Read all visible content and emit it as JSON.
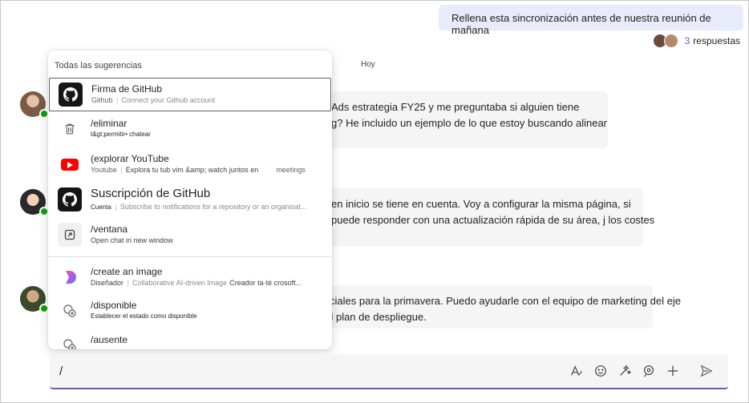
{
  "chat": {
    "outgoing_message": "Rellena esta sincronización antes de nuestra reunión de mañana",
    "replies": {
      "count": "3",
      "label": "respuestas"
    },
    "day_separator": "Hoy",
    "messages": [
      {
        "lines": [
          "Ads estrategia FY25 y me preguntaba si alguien tiene",
          "g? He incluido un ejemplo de lo que estoy buscando alinear"
        ]
      },
      {
        "lines": [
          "en inicio se tiene en cuenta. Voy a configurar la misma página, si",
          "puede responder con una actualización rápida de su área, j los costes"
        ]
      },
      {
        "lines": [
          "iniciales para la primavera. Puedo ayudarle con el equipo de marketing del eje",
          "del plan de despliegue."
        ]
      }
    ]
  },
  "suggestions": {
    "title": "Todas las sugerencias",
    "items": [
      {
        "name": "Firma de GitHub",
        "source": "Github",
        "desc": "Connect your Github account",
        "icon": "github-icon"
      },
      {
        "name": "/eliminar",
        "source": "",
        "desc": "t&gt;permitir• chatear",
        "icon": "trash-icon"
      },
      {
        "name": "(explorar YouTube",
        "source": "Youtube",
        "desc": "Explora tu tub vim &amp; watch juntos en",
        "extra": "meetings",
        "icon": "youtube-icon"
      },
      {
        "name": "Suscripción de GitHub",
        "source": "Cuenta",
        "desc": "Subscribe to notifications for a repository or an organisat...",
        "icon": "github-icon"
      },
      {
        "name": "/ventana",
        "source": "",
        "desc": "Open chat in new window",
        "icon": "open-window-icon"
      },
      {
        "name": "/create an image",
        "source": "Diseñador",
        "desc": "Collaborative AI-driven Image",
        "extra": "Creador ta·té crosoft...",
        "icon": "designer-icon"
      },
      {
        "name": "/disponible",
        "source": "",
        "desc": "Establecer el estado como disponible",
        "icon": "status-icon"
      },
      {
        "name": "/ausente",
        "source": "",
        "desc": "",
        "icon": "status-icon"
      }
    ]
  },
  "composer": {
    "value": "/",
    "toolbar": [
      "format-icon",
      "emoji-icon",
      "copilot-icon",
      "loop-icon",
      "plus-icon",
      "send-icon"
    ]
  },
  "colors": {
    "accent": "#5b5fc7",
    "outgoing_bubble": "#e8ebfa",
    "presence": "#13a10e"
  }
}
